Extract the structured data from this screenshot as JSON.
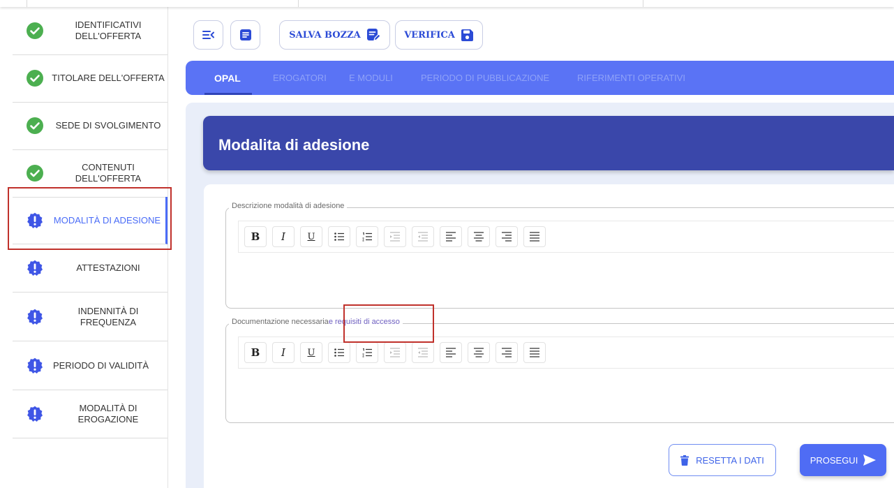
{
  "steps": [
    {
      "label": "IDENTIFICATIVI DELL'OFFERTA",
      "status": "complete"
    },
    {
      "label": "TITOLARE DELL'OFFERTA",
      "status": "complete"
    },
    {
      "label": "SEDE DI SVOLGIMENTO",
      "status": "complete"
    },
    {
      "label": "CONTENUTI DELL'OFFERTA",
      "status": "complete"
    },
    {
      "label": "MODALITÀ DI ADESIONE",
      "status": "warning",
      "active": true
    },
    {
      "label": "ATTESTAZIONI",
      "status": "warning"
    },
    {
      "label": "INDENNITÀ DI FREQUENZA",
      "status": "warning"
    },
    {
      "label": "PERIODO DI VALIDITÀ",
      "status": "warning"
    },
    {
      "label": "MODALITÀ DI EROGAZIONE",
      "status": "warning"
    }
  ],
  "toolbar": {
    "collapse_icon": "collapse-menu-icon",
    "notes_icon": "document-icon",
    "save_draft_label": "SALVA BOZZA",
    "save_draft_icon": "file-edit-icon",
    "verify_label": "VERIFICA",
    "verify_icon": "floppy-disk-icon"
  },
  "tabs": [
    "OPAL",
    "EROGATORI",
    "E MODULI",
    "PERIODO DI PUBBLICAZIONE",
    "RIFERIMENTI OPERATIVI"
  ],
  "section": {
    "title": "Modalita di adesione"
  },
  "fields": {
    "descrizione": {
      "legend": "Descrizione modalità di adesione",
      "value": ""
    },
    "documentazione": {
      "legend_part1": "Documentazione necessaria",
      "legend_part2": "e requisiti di accesso",
      "value": ""
    }
  },
  "editor_tools": [
    "bold",
    "italic",
    "underline",
    "bullet-list",
    "numbered-list",
    "indent",
    "outdent",
    "align-left",
    "align-center",
    "align-right",
    "justify"
  ],
  "editor_glyphs": {
    "bold": "B",
    "italic": "I",
    "underline": "U"
  },
  "actions": {
    "reset_label": "RESETTA I DATI",
    "reset_icon": "trash-icon",
    "next_label": "PROSEGUI",
    "next_icon": "send-icon"
  },
  "colors": {
    "accent": "#4f6cf4",
    "banner": "#3a47aa",
    "success": "#4caf50",
    "warning": "#3f56e6",
    "highlight": "#c0312b"
  }
}
